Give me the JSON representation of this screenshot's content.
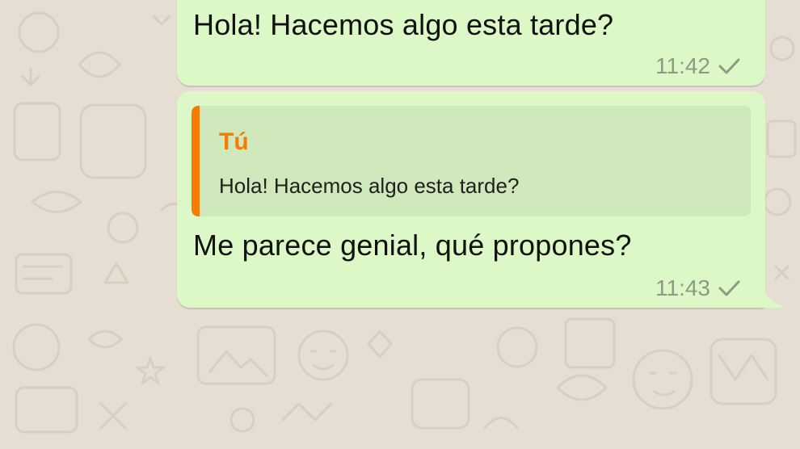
{
  "chat": {
    "messages": [
      {
        "text": "Hola! Hacemos algo esta tarde?",
        "time": "11:42",
        "status_icon": "single-check-icon"
      },
      {
        "quote": {
          "author": "Tú",
          "text": "Hola! Hacemos algo esta tarde?"
        },
        "text": "Me parece genial, qué propones?",
        "time": "11:43",
        "status_icon": "single-check-icon"
      }
    ]
  },
  "colors": {
    "wallpaper": "#e7ded3",
    "outgoing_bubble": "#dcf8c6",
    "quote_background": "#cfe9bc",
    "quote_accent": "#f57c00",
    "meta_text": "#8c9a86"
  }
}
